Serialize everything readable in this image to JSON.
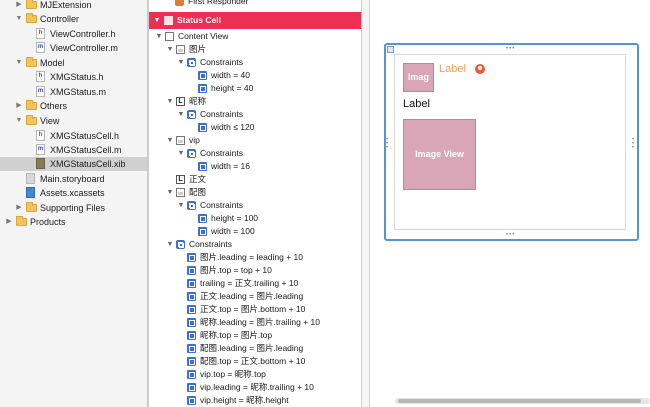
{
  "navigator": {
    "items": [
      {
        "label": "MJExtension",
        "type": "folder",
        "expanded": false
      },
      {
        "label": "Controller",
        "type": "folder",
        "expanded": true
      },
      {
        "label": "ViewController.h",
        "type": "h",
        "badge": "h"
      },
      {
        "label": "ViewController.m",
        "type": "m",
        "badge": "m"
      },
      {
        "label": "Model",
        "type": "folder",
        "expanded": true
      },
      {
        "label": "XMGStatus.h",
        "type": "h",
        "badge": "h"
      },
      {
        "label": "XMGStatus.m",
        "type": "m",
        "badge": "m"
      },
      {
        "label": "Others",
        "type": "folder",
        "expanded": false
      },
      {
        "label": "View",
        "type": "folder",
        "expanded": true
      },
      {
        "label": "XMGStatusCell.h",
        "type": "h",
        "badge": "h"
      },
      {
        "label": "XMGStatusCell.m",
        "type": "m",
        "badge": "m"
      },
      {
        "label": "XMGStatusCell.xib",
        "type": "xib",
        "badge": ""
      },
      {
        "label": "Main.storyboard",
        "type": "sb",
        "badge": ""
      },
      {
        "label": "Assets.xcassets",
        "type": "assets",
        "badge": ""
      },
      {
        "label": "Supporting Files",
        "type": "folder",
        "expanded": false
      },
      {
        "label": "Products",
        "type": "folder",
        "expanded": false
      }
    ]
  },
  "outline": {
    "first_responder": "First Responder",
    "status_cell": "Status Cell",
    "rows": [
      {
        "label": "Content View",
        "icon": "view",
        "badge": ""
      },
      {
        "label": "图片",
        "icon": "img",
        "badge": ""
      },
      {
        "label": "Constraints",
        "icon": "cons",
        "badge": ""
      },
      {
        "label": "width = 40",
        "icon": "cv",
        "badge": ""
      },
      {
        "label": "height = 40",
        "icon": "cv",
        "badge": ""
      },
      {
        "label": "昵称",
        "icon": "lbl",
        "badge": "L"
      },
      {
        "label": "Constraints",
        "icon": "cons",
        "badge": ""
      },
      {
        "label": "width ≤ 120",
        "icon": "cv",
        "badge": ""
      },
      {
        "label": "vip",
        "icon": "img",
        "badge": ""
      },
      {
        "label": "Constraints",
        "icon": "cons",
        "badge": ""
      },
      {
        "label": "width = 16",
        "icon": "cv",
        "badge": ""
      },
      {
        "label": "正文",
        "icon": "lbl",
        "badge": "L"
      },
      {
        "label": "配图",
        "icon": "img",
        "badge": ""
      },
      {
        "label": "Constraints",
        "icon": "cons",
        "badge": ""
      },
      {
        "label": "height = 100",
        "icon": "cv",
        "badge": ""
      },
      {
        "label": "width = 100",
        "icon": "cv",
        "badge": ""
      },
      {
        "label": "Constraints",
        "icon": "cons",
        "badge": ""
      },
      {
        "label": "图片.leading = leading + 10",
        "icon": "cv",
        "badge": ""
      },
      {
        "label": "图片.top = top + 10",
        "icon": "cv",
        "badge": ""
      },
      {
        "label": "trailing = 正文.trailing + 10",
        "icon": "cv",
        "badge": ""
      },
      {
        "label": "正文.leading = 图片.leading",
        "icon": "cv",
        "badge": ""
      },
      {
        "label": "正文.top = 图片.bottom + 10",
        "icon": "cv",
        "badge": ""
      },
      {
        "label": "昵称.leading = 图片.trailing + 10",
        "icon": "cv",
        "badge": ""
      },
      {
        "label": "昵称.top = 图片.top",
        "icon": "cv",
        "badge": ""
      },
      {
        "label": "配图.leading = 图片.leading",
        "icon": "cv",
        "badge": ""
      },
      {
        "label": "配图.top = 正文.bottom + 10",
        "icon": "cv",
        "badge": ""
      },
      {
        "label": "vip.top = 昵称.top",
        "icon": "cv",
        "badge": ""
      },
      {
        "label": "vip.leading = 昵称.trailing + 10",
        "icon": "cv",
        "badge": ""
      },
      {
        "label": "vip.height = 昵称.height",
        "icon": "cv",
        "badge": ""
      }
    ]
  },
  "canvas": {
    "avatar_text": "Imag",
    "name_label": "Label",
    "vip_symbol": "☻",
    "text_label": "Label",
    "picture_text": "Image View",
    "handle_dots": "•••"
  },
  "colors": {
    "status_cell_highlight": "#ec2f52",
    "selection_border": "#5a92d6",
    "placeholder_image": "#d9a6b7",
    "name_label": "#f0a35a"
  }
}
